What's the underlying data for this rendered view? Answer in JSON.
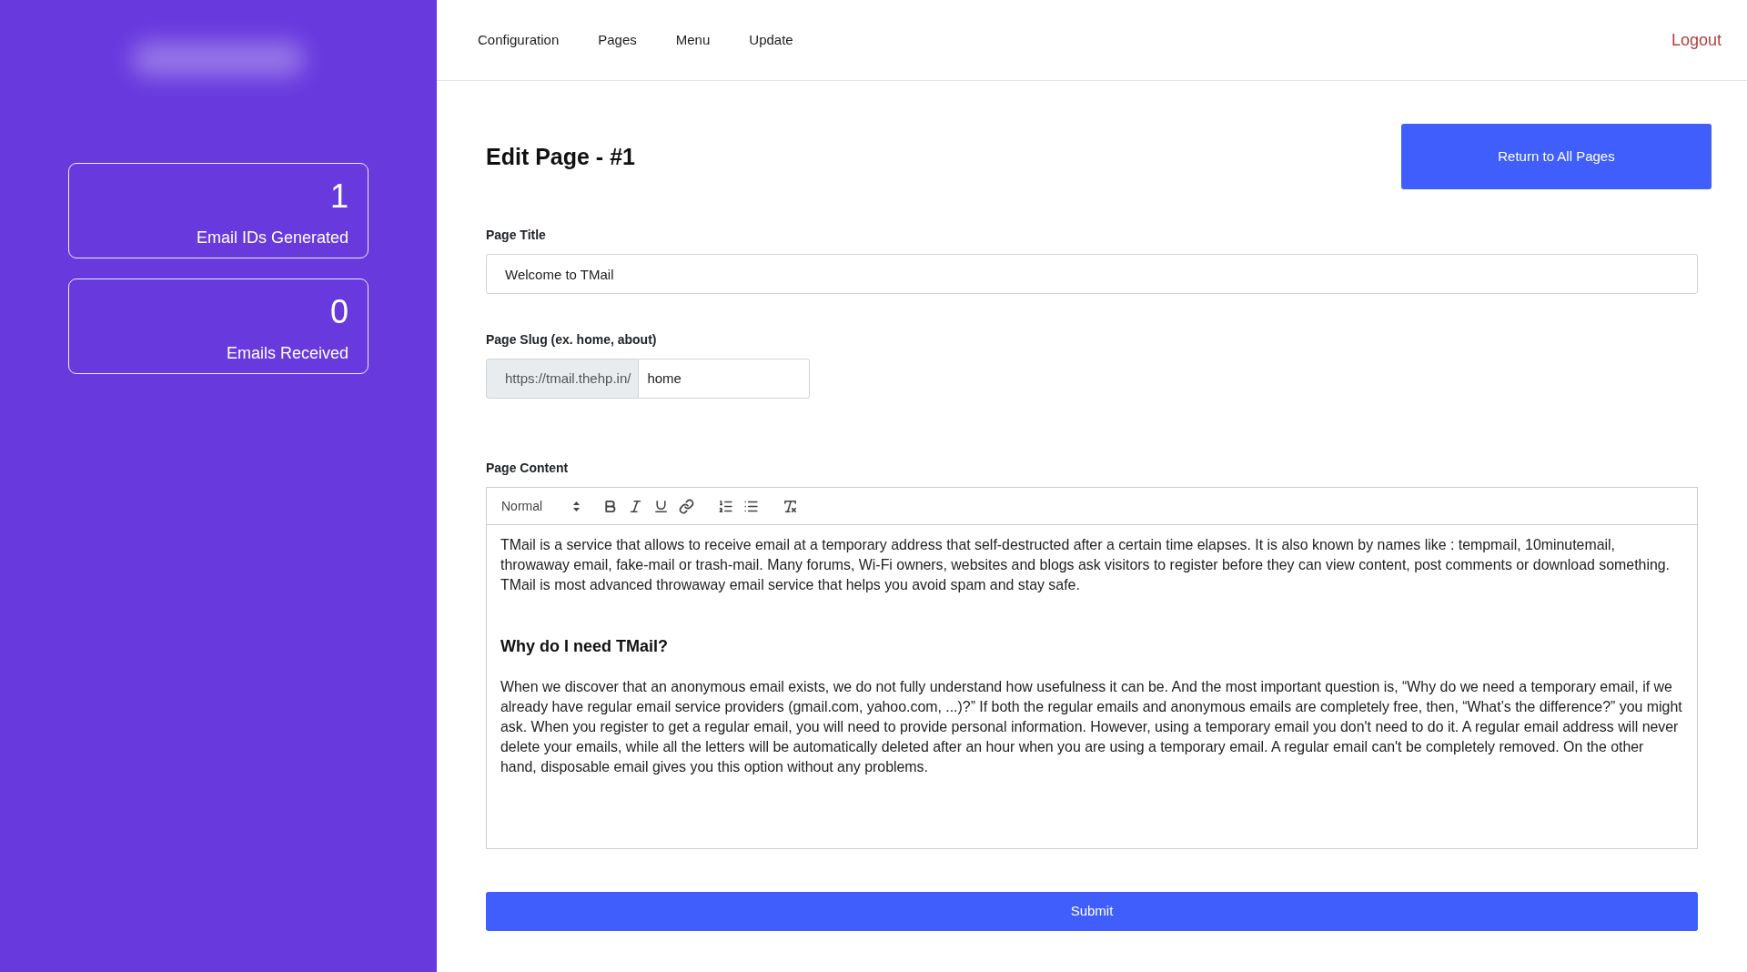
{
  "sidebar": {
    "stats": [
      {
        "value": "1",
        "label": "Email IDs Generated"
      },
      {
        "value": "0",
        "label": "Emails Received"
      }
    ]
  },
  "navbar": {
    "links": [
      "Configuration",
      "Pages",
      "Menu",
      "Update"
    ],
    "logout": "Logout"
  },
  "header": {
    "title": "Edit Page - #1",
    "return_button": "Return to All Pages"
  },
  "form": {
    "page_title": {
      "label": "Page Title",
      "value": "Welcome to TMail"
    },
    "page_slug": {
      "label": "Page Slug (ex. home, about)",
      "prefix": "https://tmail.thehp.in/",
      "value": "home"
    },
    "page_content": {
      "label": "Page Content",
      "format": "Normal",
      "blocks": [
        {
          "kind": "paragraph",
          "text": "TMail is a service that allows to receive email at a temporary address that self-destructed after a certain time elapses. It is also known by names like : tempmail, 10minutemail, throwaway email, fake-mail or trash-mail. Many forums, Wi-Fi owners, websites and blogs ask visitors to register before they can view content, post comments or download something. TMail is most advanced throwaway email service that helps you avoid spam and stay safe."
        },
        {
          "kind": "heading",
          "text": "Why do I need TMail?"
        },
        {
          "kind": "paragraph",
          "text": "When we discover that an anonymous email exists, we do not fully understand how usefulness it can be. And the most important question is, “Why do we need a temporary email, if we already have regular email service providers (gmail.com, yahoo.com, ...)?” If both the regular emails and anonymous emails are completely free, then, “What’s the difference?” you might ask. When you register to get a regular email, you will need to provide personal information. However, using a temporary email you don't need to do it. A regular email address will never delete your emails, while all the letters will be automatically deleted after an hour when you are using a temporary email. A regular email can't be completely removed. On the other hand, disposable email gives you this option without any problems."
        }
      ]
    },
    "submit_button": "Submit"
  }
}
